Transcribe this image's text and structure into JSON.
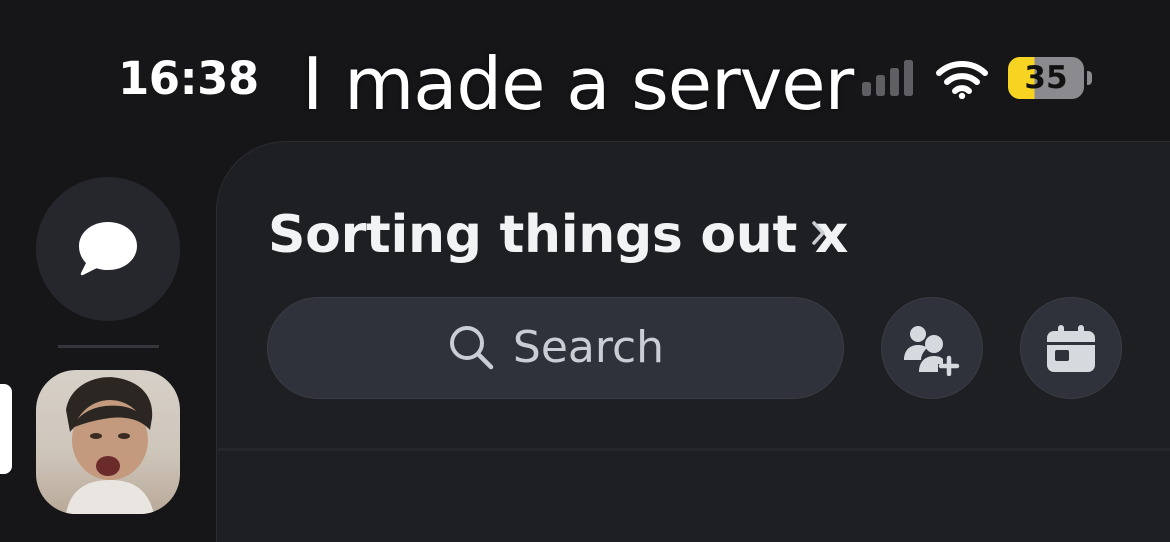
{
  "status_bar": {
    "time": "16:38",
    "battery_level": "35",
    "icons": [
      "cellular-signal-icon",
      "wifi-icon",
      "battery-icon"
    ]
  },
  "overlay_caption": "I made a server",
  "left_rail": {
    "direct_messages_icon": "chat-bubble-icon",
    "selected_server_avatar": "avatar"
  },
  "server_header": {
    "title": "Sorting things out x",
    "chevron_icon": "chevron-right-icon"
  },
  "search": {
    "placeholder": "Search",
    "icon": "search-icon"
  },
  "actions": {
    "invite_icon": "add-member-icon",
    "events_icon": "calendar-icon"
  },
  "colors": {
    "background": "#161619",
    "panel": "#1e1f23",
    "control": "#2f323a",
    "battery_low": "#f8d422",
    "text": "#f2f3f5"
  }
}
